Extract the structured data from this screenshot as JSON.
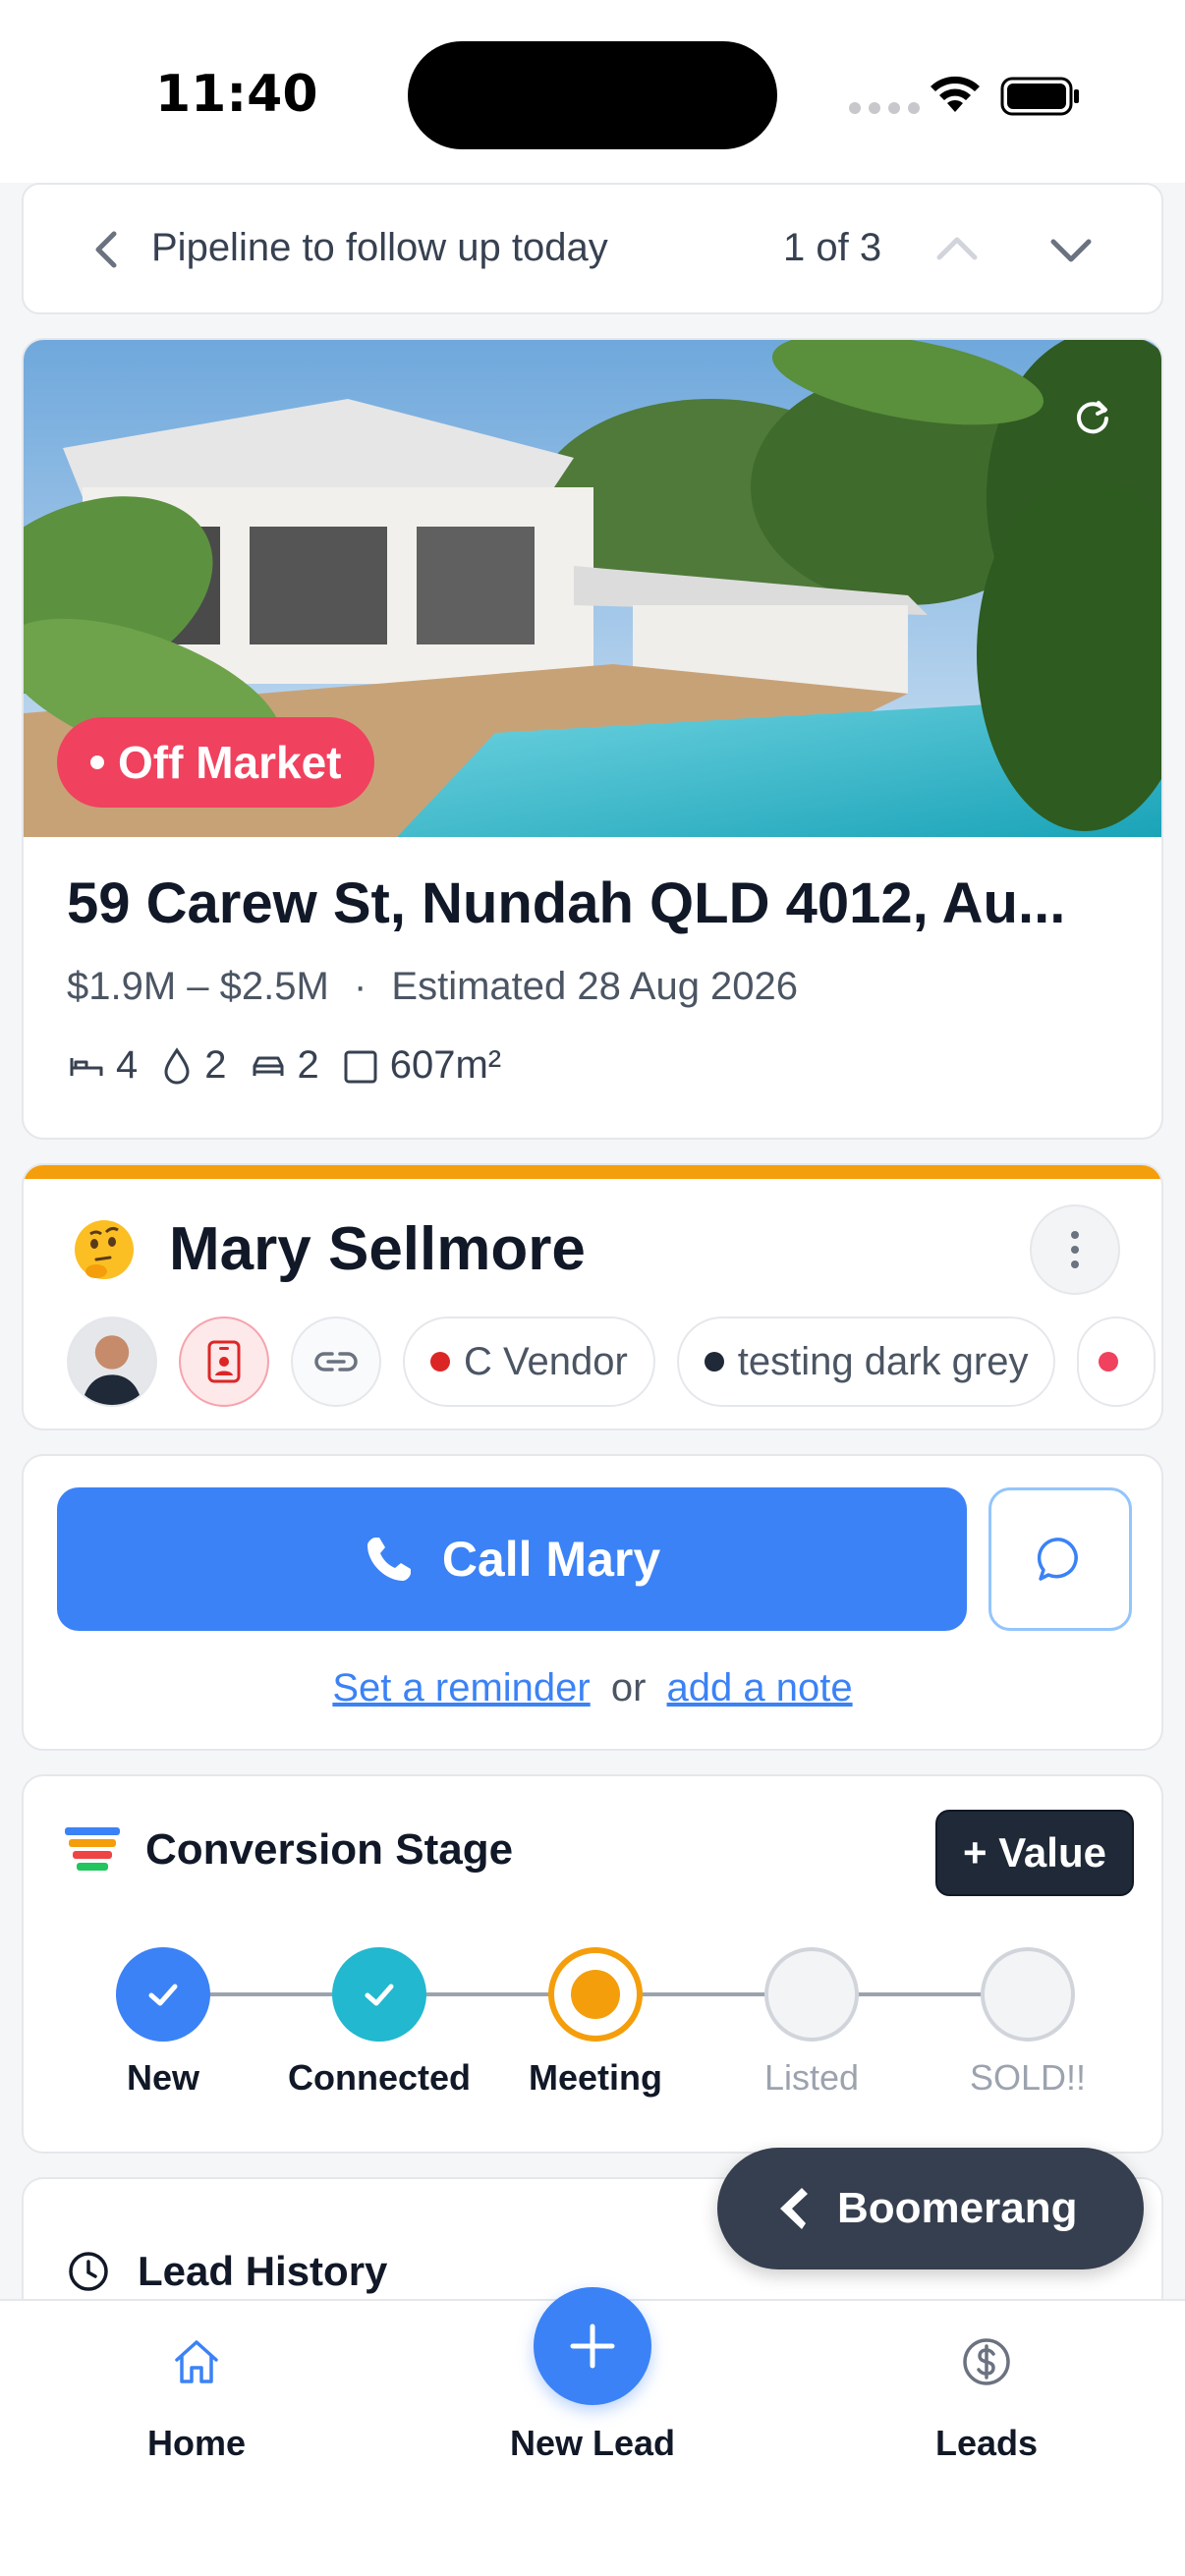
{
  "status_bar": {
    "time": "11:40"
  },
  "pipeline": {
    "title": "Pipeline to follow up today",
    "count": "1 of 3"
  },
  "property": {
    "badge": "Off Market",
    "address": "59 Carew St, Nundah QLD 4012, Au...",
    "price": "$1.9M – $2.5M",
    "separator": "·",
    "estimated": "Estimated 28 Aug 2026",
    "features": {
      "beds": "4",
      "baths": "2",
      "cars": "2",
      "land": "607m²"
    }
  },
  "contact": {
    "emoji": "🤔",
    "name": "Mary Sellmore",
    "tags": [
      {
        "label": "C Vendor",
        "color": "#dc2626"
      },
      {
        "label": "testing dark grey",
        "color": "#1f2937"
      }
    ]
  },
  "call": {
    "button_label": "Call Mary",
    "reminder_link": "Set a reminder",
    "or_text": "or",
    "note_link": "add a note"
  },
  "conversion": {
    "title": "Conversion Stage",
    "value_button": "+ Value",
    "stages": [
      {
        "label": "New",
        "state": "done"
      },
      {
        "label": "Connected",
        "state": "done"
      },
      {
        "label": "Meeting",
        "state": "current"
      },
      {
        "label": "Listed",
        "state": "pending"
      },
      {
        "label": "SOLD!!",
        "state": "pending"
      }
    ]
  },
  "history": {
    "title": "Lead History"
  },
  "boomerang": {
    "label": "Boomerang"
  },
  "nav": {
    "home": "Home",
    "new_lead": "New Lead",
    "leads": "Leads"
  },
  "colors": {
    "accent": "#3b82f6",
    "off_market": "#f0415e",
    "contact_stripe": "#f59e0b",
    "stage_new": "#3b82f6",
    "stage_connected": "#22b8cf",
    "stage_meeting": "#f59e0b"
  }
}
